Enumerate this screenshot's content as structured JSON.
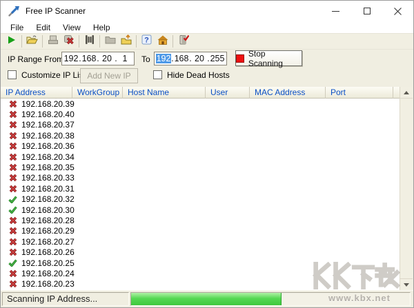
{
  "window": {
    "title": "Free IP Scanner",
    "controls": [
      "minimize",
      "maximize",
      "close"
    ]
  },
  "menu": {
    "items": [
      "File",
      "Edit",
      "View",
      "Help"
    ]
  },
  "toolbar": {
    "icons": [
      "start-scan-icon",
      "open-icon",
      "save-disabled-icon",
      "delete-icon",
      "find-icon",
      "folder-disabled-icon",
      "export-folder-icon",
      "help-icon",
      "home-icon",
      "exit-icon"
    ]
  },
  "controls": {
    "ip_range_label": "IP Range From",
    "from_ip": [
      "192",
      "168",
      "20",
      "1"
    ],
    "to_label": "To",
    "to_ip": [
      "192",
      "168",
      "20",
      "255"
    ],
    "to_ip_selected_segment": 0,
    "stop_button": "Stop Scanning",
    "customize_checkbox": "Customize IP List",
    "add_new_ip_button": "Add New IP",
    "hide_dead_checkbox": "Hide Dead Hosts"
  },
  "table": {
    "columns": [
      "IP Address",
      "WorkGroup Name",
      "Host Name",
      "User",
      "MAC Address",
      "Port"
    ],
    "rows": [
      {
        "status": "dead",
        "ip": "192.168.20.39"
      },
      {
        "status": "dead",
        "ip": "192.168.20.40"
      },
      {
        "status": "dead",
        "ip": "192.168.20.37"
      },
      {
        "status": "dead",
        "ip": "192.168.20.38"
      },
      {
        "status": "dead",
        "ip": "192.168.20.36"
      },
      {
        "status": "dead",
        "ip": "192.168.20.34"
      },
      {
        "status": "dead",
        "ip": "192.168.20.35"
      },
      {
        "status": "dead",
        "ip": "192.168.20.33"
      },
      {
        "status": "dead",
        "ip": "192.168.20.31"
      },
      {
        "status": "alive",
        "ip": "192.168.20.32"
      },
      {
        "status": "alive",
        "ip": "192.168.20.30"
      },
      {
        "status": "dead",
        "ip": "192.168.20.28"
      },
      {
        "status": "dead",
        "ip": "192.168.20.29"
      },
      {
        "status": "dead",
        "ip": "192.168.20.27"
      },
      {
        "status": "dead",
        "ip": "192.168.20.26"
      },
      {
        "status": "alive",
        "ip": "192.168.20.25"
      },
      {
        "status": "dead",
        "ip": "192.168.20.24"
      },
      {
        "status": "dead",
        "ip": "192.168.20.23"
      }
    ]
  },
  "status_bar": {
    "text": "Scanning IP Address...",
    "progress_percent": 54
  },
  "watermark": {
    "logo": "KK下载",
    "url": "www.kbx.net"
  },
  "colors": {
    "dead_x": "#c62a2a",
    "alive_check": "#2ca32c",
    "progress_green": "#4ed24c",
    "header_text": "#0a4fc4",
    "stop_red": "#ee1111",
    "selection_blue": "#4f9ae8"
  }
}
